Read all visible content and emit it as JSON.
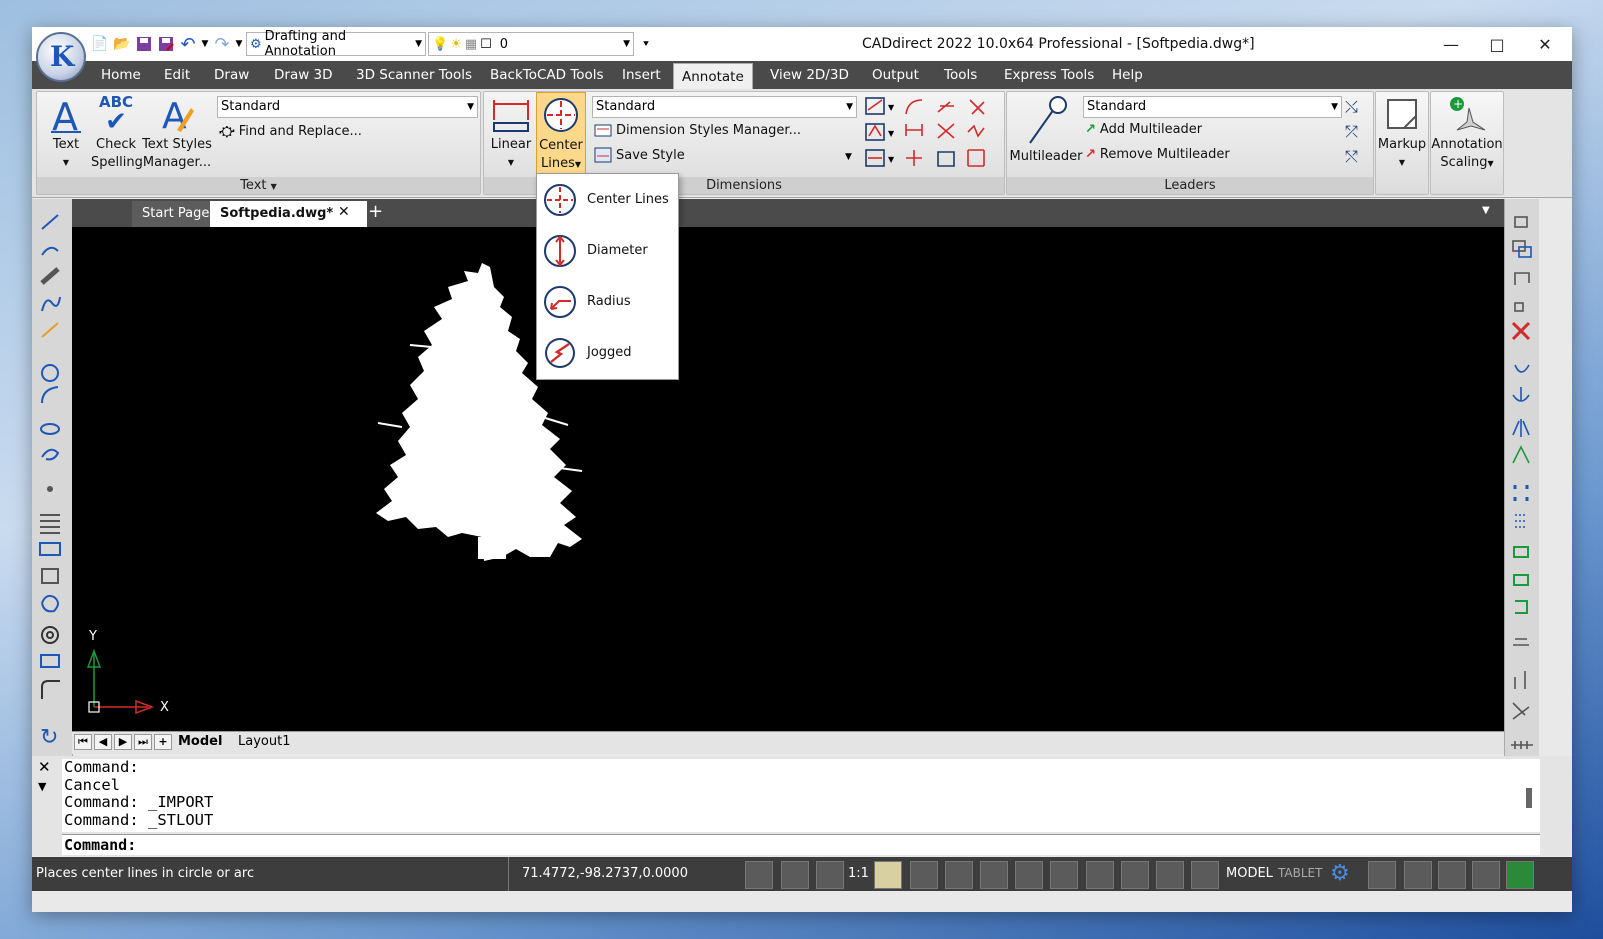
{
  "titlebar": {
    "title": "CADdirect 2022 10.0x64 Professional  - [Softpedia.dwg*]",
    "workspace": "Drafting and Annotation",
    "layer_value": "0",
    "minimize": "—",
    "maximize": "□",
    "close": "✕"
  },
  "menu": [
    "Home",
    "Edit",
    "Draw",
    "Draw 3D",
    "3D Scanner Tools",
    "BackToCAD Tools",
    "Insert",
    "Annotate",
    "View 2D/3D",
    "Output",
    "Tools",
    "Express Tools",
    "Help"
  ],
  "ribbon": {
    "text_panel": {
      "label": "Text",
      "text_btn": "Text",
      "check_btn": "Check",
      "spelling_btn": "Spelling",
      "text_styles_btn": "Text Styles",
      "manager_btn": "Manager...",
      "abc": "ABC",
      "style_value": "Standard",
      "find_replace": "Find and Replace..."
    },
    "dimensions_panel": {
      "label": "Dimensions",
      "linear_btn": "Linear",
      "center_btn_line1": "Center",
      "center_btn_line2": "Lines",
      "style_value": "Standard",
      "dim_styles_manager": "Dimension Styles Manager...",
      "save_style": "Save Style"
    },
    "leaders_panel": {
      "label": "Leaders",
      "multileader_btn": "Multileader",
      "style_value": "Standard",
      "add_multileader": "Add Multileader",
      "remove_multileader": "Remove Multileader"
    },
    "markup_btn": "Markup",
    "annotation_scaling_line1": "Annotation",
    "annotation_scaling_line2": "Scaling"
  },
  "dropdown": {
    "items": [
      "Center Lines",
      "Diameter",
      "Radius",
      "Jogged"
    ]
  },
  "tabs": {
    "start_page": "Start Page",
    "document": "Softpedia.dwg*",
    "close": "✕",
    "add": "+"
  },
  "ucs": {
    "y": "Y",
    "x": "X"
  },
  "layout_tabs": [
    "Model",
    "Layout1"
  ],
  "command": {
    "history": [
      "Command:",
      "Cancel",
      "Command: _IMPORT",
      "Command: _STLOUT"
    ],
    "prompt": "Command:"
  },
  "status": {
    "message": "Places center lines in circle or arc",
    "coordinates": "71.4772,-98.2737,0.0000",
    "scale": "1:1",
    "model": "MODEL",
    "tablet": "TABLET"
  },
  "colors": {
    "accent": "#1d57b8",
    "red": "#d42a2a",
    "dark_bar": "#4a4a4a"
  }
}
